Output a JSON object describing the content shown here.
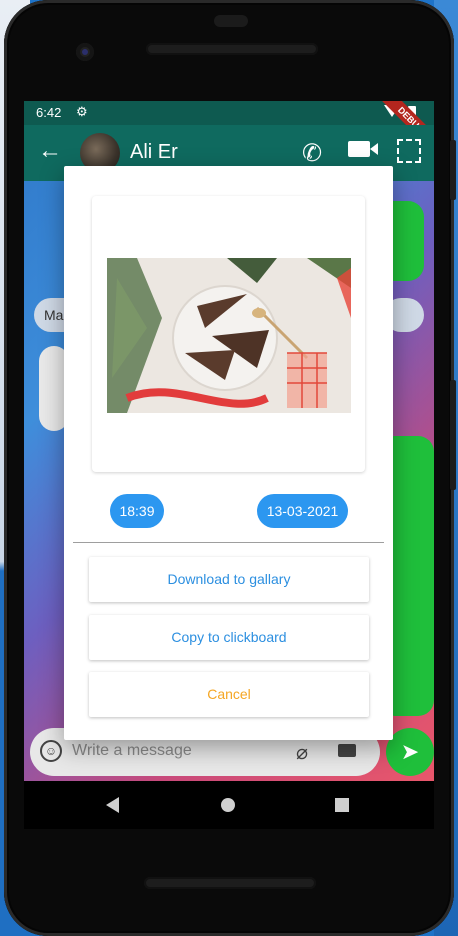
{
  "status_bar": {
    "time": "6:42",
    "debug_label": "DEBUG"
  },
  "app_bar": {
    "title": "Ali Er"
  },
  "chat": {
    "partial_text_left": "Ma",
    "input_placeholder": "Write a message"
  },
  "dialog": {
    "time": "18:39",
    "date": "13-03-2021",
    "download_label": "Download to gallary",
    "copy_label": "Copy to clickboard",
    "cancel_label": "Cancel"
  },
  "icons": {
    "back": "arrow-left-icon",
    "call": "phone-icon",
    "video": "video-camera-icon",
    "select": "select-icon",
    "emoji": "emoji-icon",
    "attach": "paperclip-icon",
    "camera": "camera-icon",
    "send": "send-icon"
  },
  "colors": {
    "accent_blue": "#2c97f0",
    "cancel_orange": "#f5a623",
    "appbar_teal": "#0f6a5f",
    "bubble_green": "#1fbf3b"
  }
}
